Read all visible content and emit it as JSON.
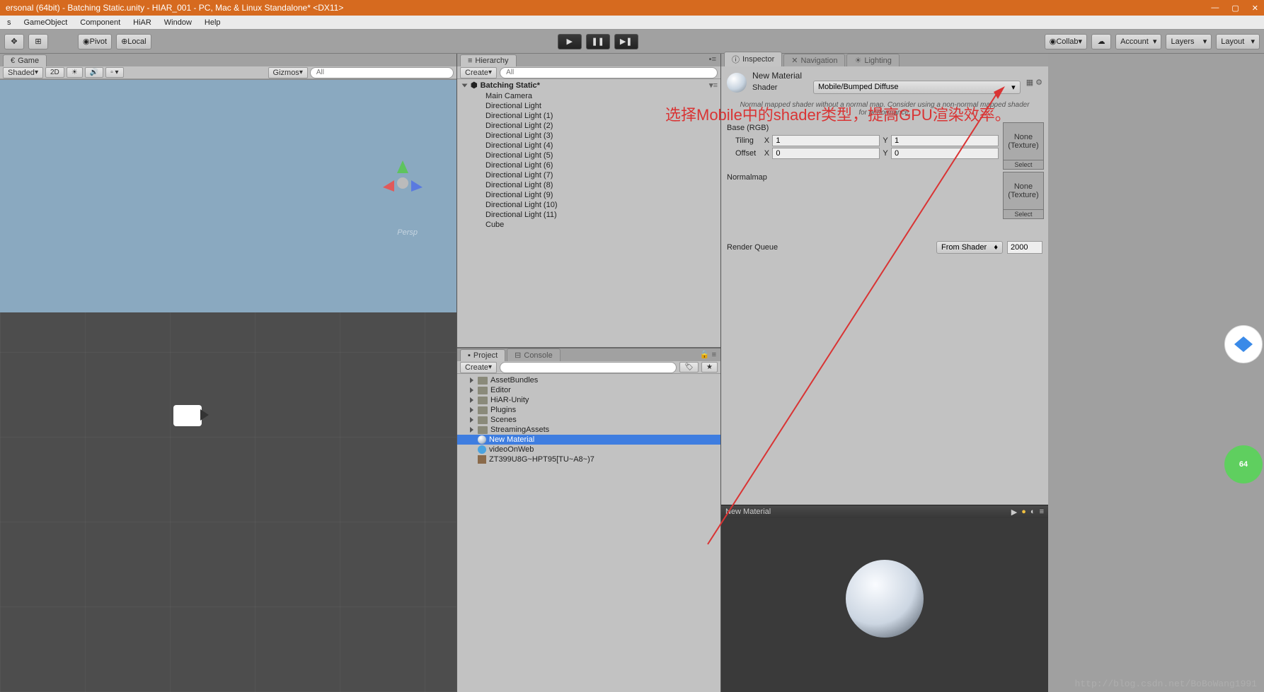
{
  "titlebar": {
    "title": "ersonal (64bit) - Batching Static.unity - HIAR_001 - PC, Mac & Linux Standalone* <DX11>"
  },
  "menubar": {
    "items": [
      "s",
      "GameObject",
      "Component",
      "HiAR",
      "Window",
      "Help"
    ]
  },
  "toolbar": {
    "pivot": "Pivot",
    "local": "Local",
    "collab": "Collab",
    "account": "Account",
    "layers": "Layers",
    "layout": "Layout"
  },
  "sceneTab": {
    "game": "Game",
    "shaded": "Shaded",
    "twoD": "2D",
    "gizmos": "Gizmos",
    "searchPh": "All",
    "persp": "Persp"
  },
  "hierarchy": {
    "tab": "Hierarchy",
    "create": "Create",
    "searchPh": "All",
    "scene": "Batching Static*",
    "items": [
      "Main Camera",
      "Directional Light",
      "Directional Light (1)",
      "Directional Light (2)",
      "Directional Light (3)",
      "Directional Light (4)",
      "Directional Light (5)",
      "Directional Light (6)",
      "Directional Light (7)",
      "Directional Light (8)",
      "Directional Light (9)",
      "Directional Light (10)",
      "Directional Light (11)",
      "Cube"
    ]
  },
  "project": {
    "tab": "Project",
    "consoleTab": "Console",
    "create": "Create",
    "items": [
      {
        "name": "AssetBundles",
        "type": "folder"
      },
      {
        "name": "Editor",
        "type": "folder"
      },
      {
        "name": "HiAR-Unity",
        "type": "folder"
      },
      {
        "name": "Plugins",
        "type": "folder"
      },
      {
        "name": "Scenes",
        "type": "folder"
      },
      {
        "name": "StreamingAssets",
        "type": "folder"
      },
      {
        "name": "New Material",
        "type": "material",
        "selected": true
      },
      {
        "name": "videoOnWeb",
        "type": "web"
      },
      {
        "name": "ZT399U8G~HPT95[TU~A8~)7",
        "type": "image"
      }
    ]
  },
  "inspector": {
    "tab": "Inspector",
    "navTab": "Navigation",
    "lightTab": "Lighting",
    "materialName": "New Material",
    "shaderLabel": "Shader",
    "shaderValue": "Mobile/Bumped Diffuse",
    "warning": "Normal mapped shader without a normal map. Consider using a non-normal mapped shader for performance.",
    "baseLabel": "Base (RGB)",
    "tiling": "Tiling",
    "offset": "Offset",
    "tilingX": "1",
    "tilingY": "1",
    "offsetX": "0",
    "offsetY": "0",
    "normalmap": "Normalmap",
    "texNone": "None\n(Texture)",
    "select": "Select",
    "renderQueue": "Render Queue",
    "rqSource": "From Shader",
    "rqValue": "2000",
    "previewTitle": "New Material"
  },
  "annotation": {
    "text": "选择Mobile中的shader类型，提高GPU渲染效率。"
  },
  "watermark": "http://blog.csdn.net/BoBoWang1991"
}
